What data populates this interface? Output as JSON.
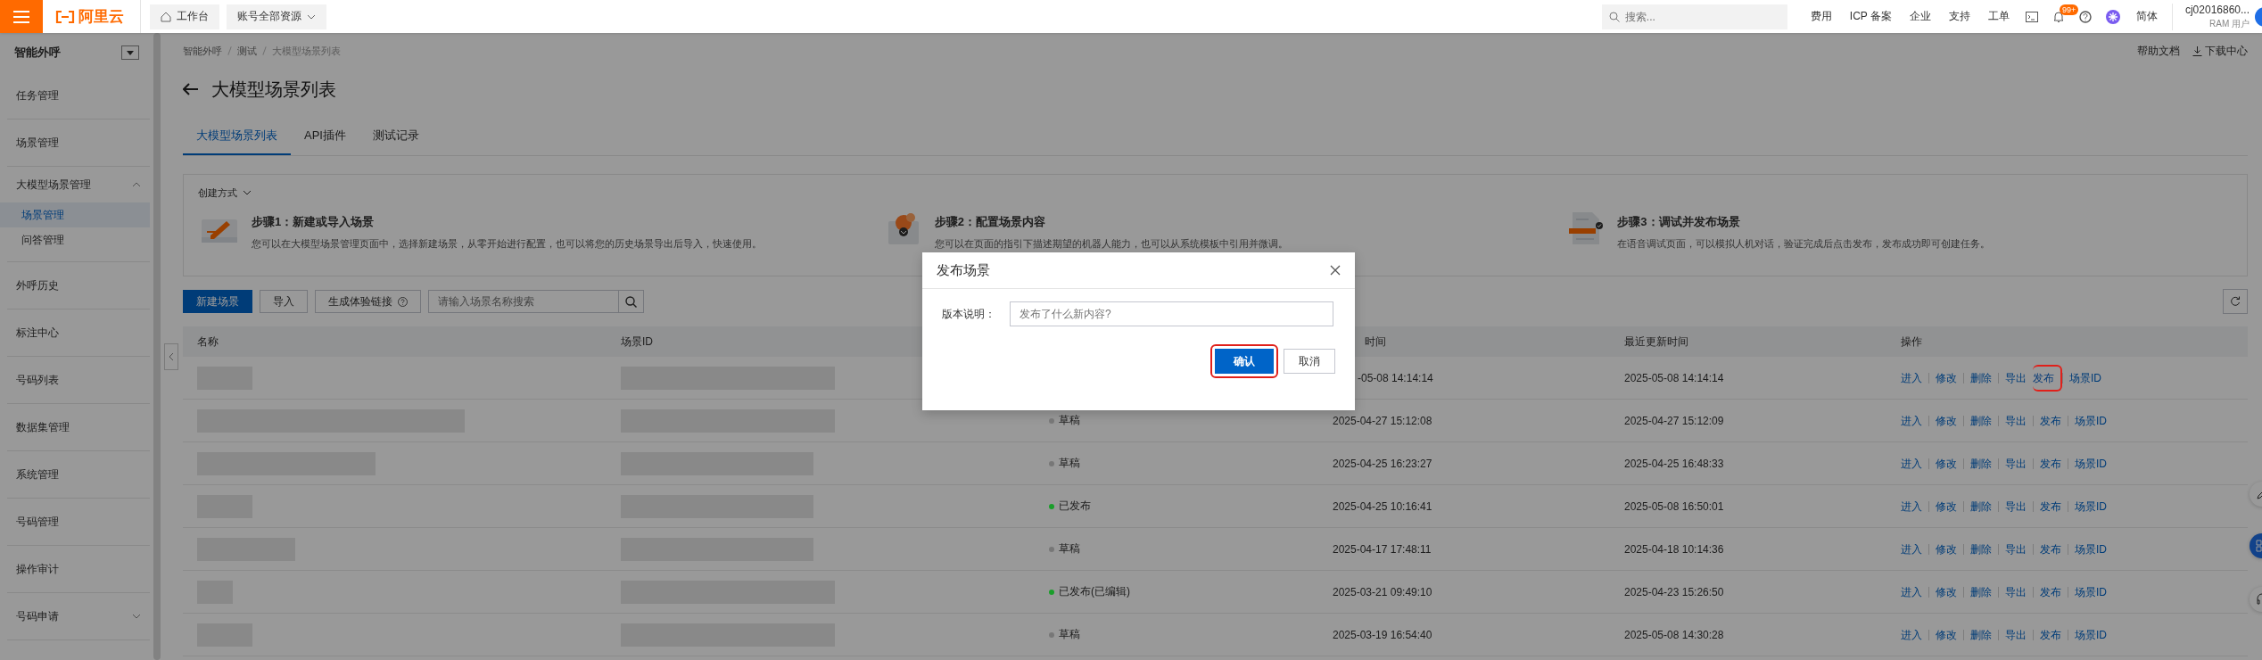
{
  "topbar": {
    "logo": "阿里云",
    "workbench": "工作台",
    "resource_scope": "账号全部资源",
    "search": {
      "placeholder": "搜索..."
    },
    "links": [
      "费用",
      "ICP 备案",
      "企业",
      "支持",
      "工单"
    ],
    "notification_badge": "99+",
    "language": "简体",
    "user": {
      "name": "cj02016860...",
      "role": "RAM 用户"
    }
  },
  "sidebar": {
    "title": "智能外呼",
    "items": [
      {
        "label": "任务管理",
        "selected": false
      },
      {
        "label": "场景管理",
        "selected": false
      },
      {
        "label": "大模型场景管理",
        "selected": false,
        "expanded": true,
        "children": [
          {
            "label": "场景管理",
            "selected": true
          },
          {
            "label": "问答管理",
            "selected": false
          }
        ]
      },
      {
        "label": "外呼历史",
        "selected": false
      },
      {
        "label": "标注中心",
        "selected": false
      },
      {
        "label": "号码列表",
        "selected": false
      },
      {
        "label": "数据集管理",
        "selected": false
      },
      {
        "label": "系统管理",
        "selected": false
      },
      {
        "label": "号码管理",
        "selected": false
      },
      {
        "label": "操作审计",
        "selected": false
      },
      {
        "label": "号码申请",
        "selected": false,
        "expanded": false
      }
    ]
  },
  "breadcrumb": [
    "智能外呼",
    "测试",
    "大模型场景列表"
  ],
  "help_links": [
    {
      "label": "帮助文档",
      "kind": "text"
    },
    {
      "label": "下载中心",
      "kind": "download"
    }
  ],
  "page_title": "大模型场景列表",
  "tabs": [
    {
      "label": "大模型场景列表",
      "selected": true
    },
    {
      "label": "API插件",
      "selected": false
    },
    {
      "label": "测试记录",
      "selected": false
    }
  ],
  "create_panel": {
    "title": "创建方式",
    "expanded": true,
    "steps": [
      {
        "kind": "create",
        "title": "步骤1：新建或导入场景",
        "description": "您可以在大模型场景管理页面中，选择新建场景，从零开始进行配置，也可以将您的历史场景导出后导入，快速使用。"
      },
      {
        "kind": "configure",
        "title": "步骤2：配置场景内容",
        "description": "您可以在页面的指引下描述期望的机器人能力，也可以从系统模板中引用并微调。"
      },
      {
        "kind": "publish",
        "title": "步骤3：调试并发布场景",
        "description": "在语音调试页面，可以模拟人机对话，验证完成后点击发布，发布成功即可创建任务。"
      }
    ]
  },
  "toolbar": {
    "buttons": [
      {
        "label": "新建场景",
        "kind": "primary"
      },
      {
        "label": "导入",
        "kind": "default"
      },
      {
        "label": "生成体验链接",
        "kind": "help"
      }
    ],
    "search": {
      "placeholder": "请输入场景名称搜索"
    }
  },
  "table": {
    "columns": [
      {
        "kind": "name",
        "label": "名称"
      },
      {
        "kind": "id",
        "label": "场景ID"
      },
      {
        "kind": "status"
      },
      {
        "kind": "created",
        "label": "时间"
      },
      {
        "kind": "updated",
        "label": "最近更新时间"
      },
      {
        "kind": "actions",
        "label": "操作"
      }
    ],
    "rows": [
      {
        "created": "-05-08 14:14:14",
        "updated": "2025-05-08 14:14:14",
        "actions": [
          {
            "label": "进入",
            "highlighted": false
          },
          {
            "label": "修改",
            "highlighted": false
          },
          {
            "label": "删除",
            "highlighted": false
          },
          {
            "label": "导出",
            "highlighted": false
          },
          {
            "label": "发布",
            "highlighted": true
          },
          {
            "label": "场景ID",
            "highlighted": false
          }
        ]
      },
      {
        "status": {
          "label": "草稿",
          "color": "#777777"
        },
        "created": "2025-04-27 15:12:08",
        "updated": "2025-04-27 15:12:09",
        "actions": [
          {
            "label": "进入",
            "highlighted": false
          },
          {
            "label": "修改",
            "highlighted": false
          },
          {
            "label": "删除",
            "highlighted": false
          },
          {
            "label": "导出",
            "highlighted": false
          },
          {
            "label": "发布",
            "highlighted": false
          },
          {
            "label": "场景ID",
            "highlighted": false
          }
        ]
      },
      {
        "status": {
          "label": "草稿",
          "color": "#777777"
        },
        "created": "2025-04-25 16:23:27",
        "updated": "2025-04-25 16:48:33",
        "actions": [
          {
            "label": "进入",
            "highlighted": false
          },
          {
            "label": "修改",
            "highlighted": false
          },
          {
            "label": "删除",
            "highlighted": false
          },
          {
            "label": "导出",
            "highlighted": false
          },
          {
            "label": "发布",
            "highlighted": false
          },
          {
            "label": "场景ID",
            "highlighted": false
          }
        ]
      },
      {
        "status": {
          "label": "已发布",
          "color": "#1a9e2a"
        },
        "created": "2025-04-25 10:16:41",
        "updated": "2025-05-08 16:50:01",
        "actions": [
          {
            "label": "进入",
            "highlighted": false
          },
          {
            "label": "修改",
            "highlighted": false
          },
          {
            "label": "删除",
            "highlighted": false
          },
          {
            "label": "导出",
            "highlighted": false
          },
          {
            "label": "发布",
            "highlighted": false
          },
          {
            "label": "场景ID",
            "highlighted": false
          }
        ]
      },
      {
        "status": {
          "label": "草稿",
          "color": "#777777"
        },
        "created": "2025-04-17 17:48:11",
        "updated": "2025-04-18 10:14:36",
        "actions": [
          {
            "label": "进入",
            "highlighted": false
          },
          {
            "label": "修改",
            "highlighted": false
          },
          {
            "label": "删除",
            "highlighted": false
          },
          {
            "label": "导出",
            "highlighted": false
          },
          {
            "label": "发布",
            "highlighted": false
          },
          {
            "label": "场景ID",
            "highlighted": false
          }
        ]
      },
      {
        "status": {
          "label": "已发布(已编辑)",
          "color": "#1a9e2a"
        },
        "created": "2025-03-21 09:49:10",
        "updated": "2025-04-23 15:26:50",
        "actions": [
          {
            "label": "进入",
            "highlighted": false
          },
          {
            "label": "修改",
            "highlighted": false
          },
          {
            "label": "删除",
            "highlighted": false
          },
          {
            "label": "导出",
            "highlighted": false
          },
          {
            "label": "发布",
            "highlighted": false
          },
          {
            "label": "场景ID",
            "highlighted": false
          }
        ]
      },
      {
        "status": {
          "label": "草稿",
          "color": "#777777"
        },
        "created": "2025-03-19 16:54:40",
        "updated": "2025-05-08 14:30:28",
        "actions": [
          {
            "label": "进入",
            "highlighted": false
          },
          {
            "label": "修改",
            "highlighted": false
          },
          {
            "label": "删除",
            "highlighted": false
          },
          {
            "label": "导出",
            "highlighted": false
          },
          {
            "label": "发布",
            "highlighted": false
          },
          {
            "label": "场景ID",
            "highlighted": false
          }
        ]
      }
    ]
  },
  "dialog": {
    "title": "发布场景",
    "field": {
      "label": "版本说明：",
      "placeholder": "发布了什么新内容?"
    },
    "buttons": [
      {
        "label": "确认",
        "kind": "primary",
        "highlighted": true
      },
      {
        "label": "取消",
        "kind": "default",
        "highlighted": false
      }
    ]
  }
}
